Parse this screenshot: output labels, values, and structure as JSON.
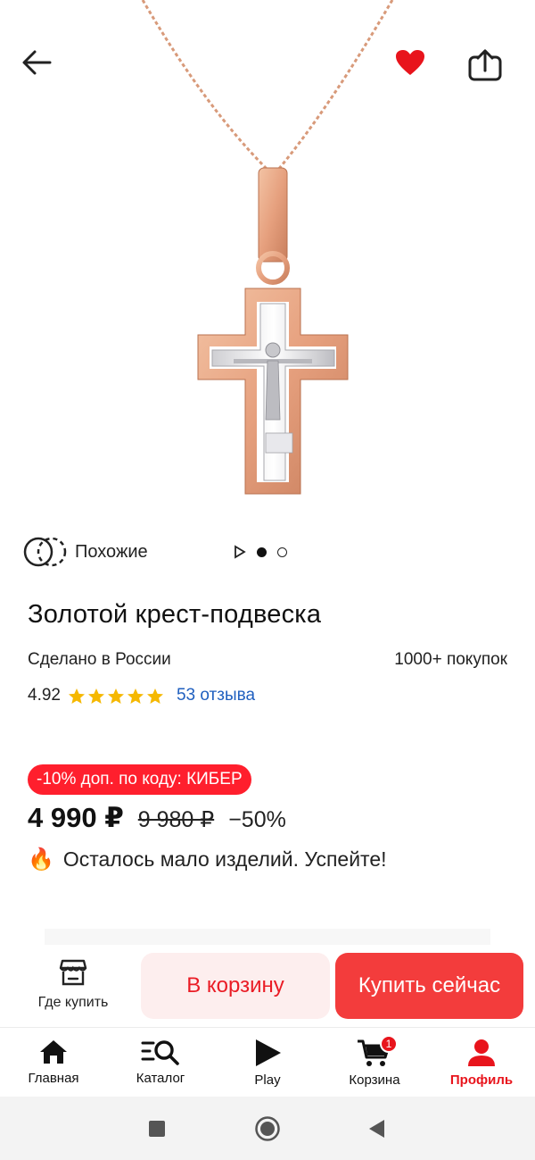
{
  "header": {
    "back_icon": "arrow-left-icon",
    "favorite_icon": "heart-icon",
    "share_icon": "share-icon",
    "favorite_color": "#e8141c"
  },
  "product_image": {
    "alt": "pendant-cross-image",
    "gallery_total": 3,
    "gallery_active": 2
  },
  "similar": {
    "label": "Похожие",
    "icon": "similar-icon"
  },
  "product": {
    "title": "Золотой крест-подвеска",
    "made_in": "Сделано в России",
    "purchases": "1000+ покупок",
    "rating": "4.92",
    "stars": 5,
    "reviews": "53 отзыва"
  },
  "pricing": {
    "promo": "-10% доп. по коду: КИБЕР",
    "price": "4 990 ₽",
    "old_price": "9 980 ₽",
    "discount": "−50%",
    "stock_emoji": "🔥",
    "stock_note": "Осталось мало изделий. Успейте!"
  },
  "actions": {
    "where_to_buy": "Где купить",
    "add_to_cart": "В корзину",
    "buy_now": "Купить сейчас"
  },
  "nav": {
    "items": [
      {
        "label": "Главная",
        "icon": "home-icon"
      },
      {
        "label": "Каталог",
        "icon": "catalog-search-icon"
      },
      {
        "label": "Play",
        "icon": "play-icon"
      },
      {
        "label": "Корзина",
        "icon": "cart-icon",
        "badge": "1"
      },
      {
        "label": "Профиль",
        "icon": "profile-icon",
        "active": true
      }
    ]
  },
  "colors": {
    "accent": "#e8141c",
    "link": "#1f5fbf",
    "star": "#f5b800"
  }
}
